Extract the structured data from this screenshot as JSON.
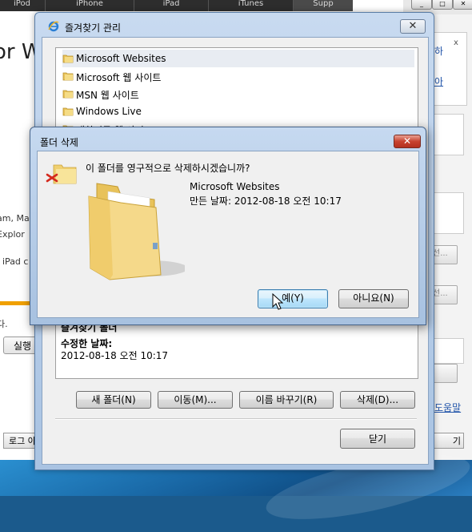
{
  "background": {
    "nav_tabs": [
      "iPod",
      "iPhone",
      "iPad",
      "iTunes",
      "Supp"
    ],
    "heading": "or W",
    "snippets": [
      "am, Ma",
      "Explor",
      ", iPad c",
      "다."
    ],
    "run_button": "실행",
    "login_button": "로그 아",
    "right_panel_text": "하",
    "right_panel_link": "아",
    "right_button_1": "선...",
    "right_button_2": "선...",
    "right_help_link": "도움말",
    "right_close_button": "기"
  },
  "favorites_window": {
    "title": "즐겨찾기 관리",
    "close_glyph": "✕",
    "tree_items": [
      {
        "label": "Microsoft Websites",
        "selected": true
      },
      {
        "label": "Microsoft 웹 사이트",
        "selected": false
      },
      {
        "label": "MSN 웹 사이트",
        "selected": false
      },
      {
        "label": "Windows Live",
        "selected": false
      },
      {
        "label": "대한민국 웹 사이트",
        "selected": false
      }
    ],
    "properties_title": "즐겨찾기 폴더",
    "modified_label": "수정한 날짜:",
    "modified_value": "2012-08-18 오전 10:17",
    "buttons": {
      "new_folder": "새 폴더(N)",
      "move": "이동(M)...",
      "rename": "이름 바꾸기(R)",
      "delete": "삭제(D)...",
      "close": "닫기"
    }
  },
  "delete_dialog": {
    "title": "폴더 삭제",
    "close_glyph": "✕",
    "question": "이 폴더를 영구적으로 삭제하시겠습니까?",
    "folder_name": "Microsoft Websites",
    "created": "만든 날짜: 2012-08-18 오전 10:17",
    "yes_button": "예(Y)",
    "no_button": "아니요(N)"
  },
  "colors": {
    "title_bar": "#b9cfea",
    "close_button_red": "#c8422f",
    "folder_yellow": "#f2d16e",
    "taskbar_blue": "#1a6aa8"
  }
}
